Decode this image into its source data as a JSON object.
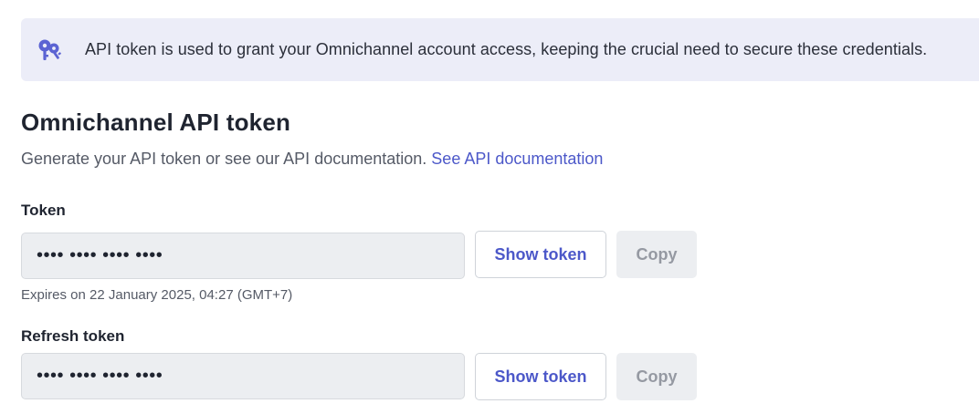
{
  "banner": {
    "icon": "keys-icon",
    "icon_color": "#5b63d3",
    "text": "API token is used to grant your Omnichannel account access, keeping the crucial need to secure these credentials."
  },
  "section": {
    "title": "Omnichannel API token",
    "description": "Generate your API token or see our API documentation.",
    "doc_link": "See API documentation"
  },
  "token": {
    "label": "Token",
    "masked_value": "•••• •••• •••• ••••",
    "show_button": "Show token",
    "copy_button": "Copy",
    "expires": "Expires on 22 January 2025, 04:27 (GMT+7)"
  },
  "refresh_token": {
    "label": "Refresh token",
    "masked_value": "•••• •••• •••• ••••",
    "show_button": "Show token",
    "copy_button": "Copy"
  },
  "colors": {
    "accent": "#4c58c9",
    "banner_bg": "#ecedf8",
    "input_bg": "#eceef1"
  }
}
